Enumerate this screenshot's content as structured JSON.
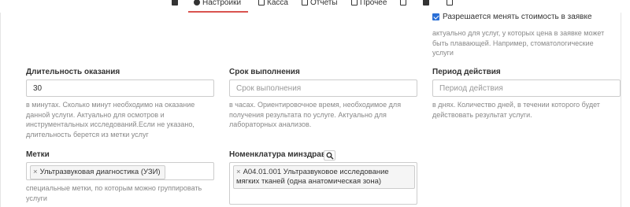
{
  "tabs": [
    {
      "label": ""
    },
    {
      "label": "Настройки"
    },
    {
      "label": "Касса"
    },
    {
      "label": "Отчеты"
    },
    {
      "label": "Прочее"
    },
    {
      "label": ""
    },
    {
      "label": ""
    },
    {
      "label": ""
    }
  ],
  "price_change": {
    "checked": true,
    "label": "Разрешается менять стоимость в заявке",
    "help": "актуально для услуг, у которых цена в заявке может быть плавающей. Например, стоматологические услуги"
  },
  "duration": {
    "label": "Длительность оказания",
    "value": "30",
    "help": "в минутах. Сколько минут необходимо на оказание данной услуги. Актуально для осмотров и инструментальных исследований.Если не указано, длительность берется из метки услуг"
  },
  "execution_time": {
    "label": "Срок выполнения",
    "placeholder": "Срок выполнения",
    "help": "в часах. Ориентировочное время, необходимое для получения результата по услуге. Актуально для лабораторных анализов."
  },
  "validity_period": {
    "label": "Период действия",
    "placeholder": "Период действия",
    "help": "в днях. Количество дней, в течении которого будет действовать результат услуги."
  },
  "tags": {
    "label": "Метки",
    "chip_remove": "×",
    "chip": "Ультразвуковая диагностика (УЗИ)",
    "help": "специальные метки, по которым можно группировать услуги"
  },
  "nomenclature": {
    "label": "Номенклатура минздрава",
    "search_icon": "search-icon",
    "chip_remove": "×",
    "chip": "A04.01.001 Ультразвуковое исследование мягких тканей (одна анатомическая зона)"
  }
}
